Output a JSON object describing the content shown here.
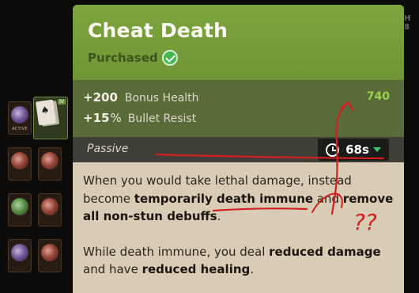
{
  "tooltip": {
    "title": "Cheat Death",
    "status": "Purchased",
    "stats": [
      {
        "sign": "+",
        "value": "200",
        "unit": "",
        "label": "Bonus Health"
      },
      {
        "sign": "+",
        "value": "15",
        "unit": "%",
        "label": "Bullet Resist"
      }
    ],
    "stat_value": "740",
    "section_label": "Passive",
    "cooldown": "68s",
    "description": {
      "p1": [
        {
          "t": "When you would take lethal damage, instead become ",
          "b": false
        },
        {
          "t": "temporarily death immune",
          "b": true
        },
        {
          "t": " and ",
          "b": false
        },
        {
          "t": "remove all non-stun debuffs",
          "b": true
        },
        {
          "t": ".",
          "b": false
        }
      ],
      "p2": [
        {
          "t": "While death immune, you deal ",
          "b": false
        },
        {
          "t": "reduced damage",
          "b": true
        },
        {
          "t": " and have ",
          "b": false
        },
        {
          "t": "reduced healing",
          "b": true
        },
        {
          "t": ".",
          "b": false
        }
      ]
    }
  },
  "background": {
    "slot_tag": "ACTIVE",
    "highlight_badge": "IV",
    "edge_letters": [
      "H",
      "8"
    ]
  },
  "annotation": {
    "marks": "??",
    "color": "#d21f1f"
  },
  "colors": {
    "header_green": "#7ea53f",
    "stats_bg": "#5a6b3a",
    "stat_value_green": "#9bd24a",
    "check_green": "#3fb84f",
    "caret_green": "#3fc56a"
  }
}
